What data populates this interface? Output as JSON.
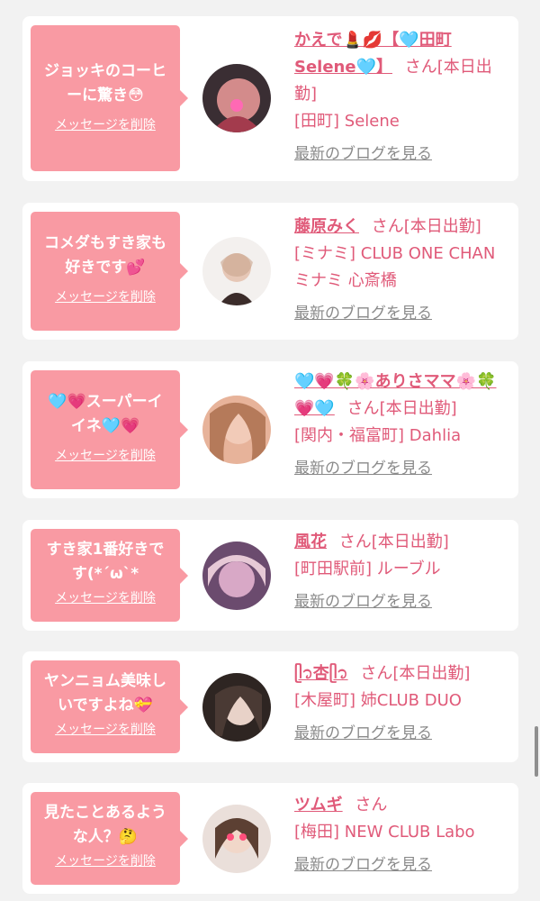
{
  "cards": [
    {
      "message_lines": [
        "ジョッキのコーヒ",
        "ーに驚き😳"
      ],
      "delete_label": "メッセージを削除",
      "name": "かえで💄💋【🩵田町Selene🩵】",
      "san": "さん",
      "status": "[本日出勤]",
      "shop": "[田町] Selene",
      "blog": "最新のブログを見る",
      "avatar_color": "#7a2b3b"
    },
    {
      "message_lines": [
        "コメダもすき家も",
        "好きです💕"
      ],
      "delete_label": "メッセージを削除",
      "name": "藤原みく",
      "san": "さん",
      "status": "[本日出勤]",
      "shop": "[ミナミ] CLUB ONE CHAN ミナミ 心斎橋",
      "blog": "最新のブログを見る",
      "avatar_color": "#e8e4e0"
    },
    {
      "message_lines": [
        "🩵💗スーパーイ",
        "イネ🩵💗"
      ],
      "delete_label": "メッセージを削除",
      "name": "🩵💗🍀🌸ありさママ🌸🍀💗🩵",
      "san": "さん",
      "status": "[本日出勤]",
      "shop": "[関内・福富町] Dahlia",
      "blog": "最新のブログを見る",
      "avatar_color": "#c88a70"
    },
    {
      "message_lines": [
        "すき家1番好きで",
        "す(*´ω`*"
      ],
      "delete_label": "メッセージを削除",
      "name": "風花",
      "san": "さん",
      "status": "[本日出勤]",
      "shop": "[町田駅前] ルーブル",
      "blog": "最新のブログを見る",
      "avatar_color": "#a77a9c"
    },
    {
      "message_lines": [
        "ヤンニョム美味し",
        "いですよね💝"
      ],
      "delete_label": "メッセージを削除",
      "name": "ᥫ᭡杏ᥫ᭡",
      "san": "さん",
      "status": "[本日出勤]",
      "shop": "[木屋町] 姉CLUB DUO",
      "blog": "最新のブログを見る",
      "avatar_color": "#3a2e2b"
    },
    {
      "message_lines": [
        "見たことあるよう",
        "な人？🤔"
      ],
      "delete_label": "メッセージを削除",
      "name": "ツムギ",
      "san": "さん",
      "status": "",
      "shop": "[梅田] NEW CLUB Labo",
      "blog": "最新のブログを見る",
      "avatar_color": "#d8c7c1"
    }
  ]
}
